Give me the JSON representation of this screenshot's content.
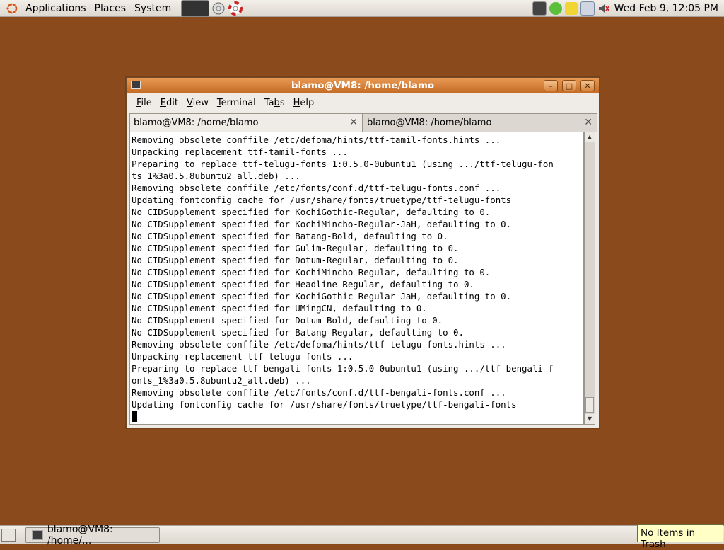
{
  "top_panel": {
    "menus": [
      "Applications",
      "Places",
      "System"
    ],
    "clock": "Wed Feb  9, 12:05 PM"
  },
  "window": {
    "title": "blamo@VM8: /home/blamo",
    "menu": {
      "file": {
        "pre": "",
        "u": "F",
        "post": "ile"
      },
      "edit": {
        "pre": "",
        "u": "E",
        "post": "dit"
      },
      "view": {
        "pre": "",
        "u": "V",
        "post": "iew"
      },
      "terminal": {
        "pre": "",
        "u": "T",
        "post": "erminal"
      },
      "tabs": {
        "pre": "Ta",
        "u": "b",
        "post": "s"
      },
      "help": {
        "pre": "",
        "u": "H",
        "post": "elp"
      }
    },
    "tabs": [
      {
        "label": "blamo@VM8: /home/blamo"
      },
      {
        "label": "blamo@VM8: /home/blamo"
      }
    ],
    "terminal_lines": [
      "Removing obsolete conffile /etc/defoma/hints/ttf-tamil-fonts.hints ...",
      "Unpacking replacement ttf-tamil-fonts ...",
      "Preparing to replace ttf-telugu-fonts 1:0.5.0-0ubuntu1 (using .../ttf-telugu-fon",
      "ts_1%3a0.5.8ubuntu2_all.deb) ...",
      "Removing obsolete conffile /etc/fonts/conf.d/ttf-telugu-fonts.conf ...",
      "Updating fontconfig cache for /usr/share/fonts/truetype/ttf-telugu-fonts",
      "No CIDSupplement specified for KochiGothic-Regular, defaulting to 0.",
      "No CIDSupplement specified for KochiMincho-Regular-JaH, defaulting to 0.",
      "No CIDSupplement specified for Batang-Bold, defaulting to 0.",
      "No CIDSupplement specified for Gulim-Regular, defaulting to 0.",
      "No CIDSupplement specified for Dotum-Regular, defaulting to 0.",
      "No CIDSupplement specified for KochiMincho-Regular, defaulting to 0.",
      "No CIDSupplement specified for Headline-Regular, defaulting to 0.",
      "No CIDSupplement specified for KochiGothic-Regular-JaH, defaulting to 0.",
      "No CIDSupplement specified for UMingCN, defaulting to 0.",
      "No CIDSupplement specified for Dotum-Bold, defaulting to 0.",
      "No CIDSupplement specified for Batang-Regular, defaulting to 0.",
      "Removing obsolete conffile /etc/defoma/hints/ttf-telugu-fonts.hints ...",
      "Unpacking replacement ttf-telugu-fonts ...",
      "Preparing to replace ttf-bengali-fonts 1:0.5.0-0ubuntu1 (using .../ttf-bengali-f",
      "onts_1%3a0.5.8ubuntu2_all.deb) ...",
      "Removing obsolete conffile /etc/fonts/conf.d/ttf-bengali-fonts.conf ...",
      "Updating fontconfig cache for /usr/share/fonts/truetype/ttf-bengali-fonts"
    ]
  },
  "bottom_panel": {
    "task_label": "blamo@VM8: /home/..."
  },
  "trash_tooltip": "No Items in Trash",
  "colors": {
    "desktop": "#8a4a1c",
    "titlebar": "#d57c36"
  }
}
